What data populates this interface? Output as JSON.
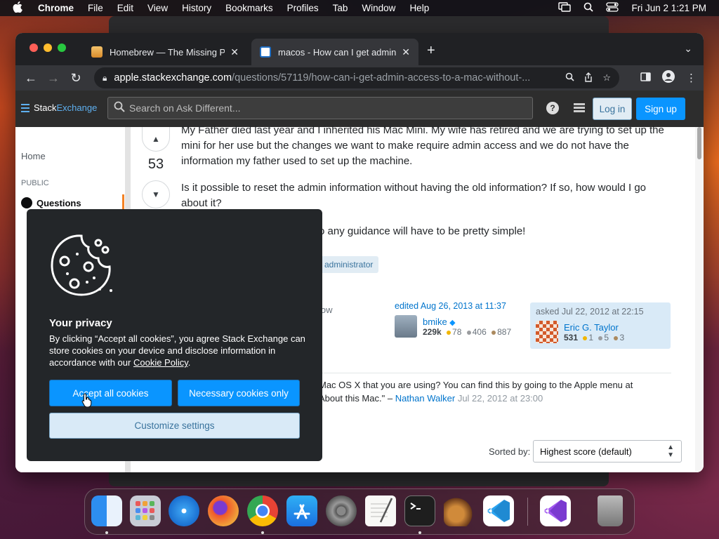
{
  "menubar": {
    "app_name": "Chrome",
    "items": [
      "File",
      "Edit",
      "View",
      "History",
      "Bookmarks",
      "Profiles",
      "Tab",
      "Window",
      "Help"
    ],
    "datetime": "Fri Jun 2  1:21 PM"
  },
  "browser": {
    "tabs": [
      {
        "title": "Homebrew — The Missing Pack",
        "active": false
      },
      {
        "title": "macos - How can I get admin a",
        "active": true
      }
    ],
    "url_host": "apple.stackexchange.com",
    "url_path": "/questions/57119/how-can-i-get-admin-access-to-a-mac-without-..."
  },
  "site_header": {
    "logo_stack": "Stack",
    "logo_exchange": "Exchange",
    "search_placeholder": "Search on Ask Different...",
    "login_label": "Log in",
    "signup_label": "Sign up"
  },
  "sidebar": {
    "home": "Home",
    "section": "PUBLIC",
    "questions": "Questions"
  },
  "question": {
    "vote_count": "53",
    "paragraph1": "My Father died last year and I inherited his Mac Mini. My wife has retired and we are trying to set up the mini for her use but the changes we want to make require admin access and we do not have the information my father used to set up the machine.",
    "paragraph2": "Is it possible to reset the admin information without having the old information? If so, how would I go about it?",
    "paragraph3_fragment": "o any guidance will have to be pretty simple!",
    "tag": "administrator",
    "follow_fragment": "low",
    "edited": {
      "label": "edited Aug 26, 2013 at 11:37",
      "user": "bmike",
      "rep": "229k",
      "gold": "78",
      "silver": "406",
      "bronze": "887"
    },
    "asked": {
      "label": "asked Jul 22, 2012 at 22:15",
      "user": "Eric G. Taylor",
      "rep": "531",
      "gold": "1",
      "silver": "5",
      "bronze": "3"
    },
    "comment": {
      "text1": "Mac OS X that you are using? You can find this by going to the Apple menu at",
      "text2": "About this Mac.\" –",
      "author": "Nathan Walker",
      "time": "Jul 22, 2012 at 23:00"
    }
  },
  "sort": {
    "label": "Sorted by:",
    "value": "Highest score (default)"
  },
  "cookie_dialog": {
    "title": "Your privacy",
    "text": "By clicking “Accept all cookies”, you agree Stack Exchange can store cookies on your device and disclose information in accordance with our",
    "policy_link": "Cookie Policy",
    "text_end": ".",
    "accept_label": "Accept all cookies",
    "necessary_label": "Necessary cookies only",
    "customize_label": "Customize settings"
  },
  "dock": {
    "apps": [
      "finder-icon",
      "launchpad-icon",
      "safari-icon",
      "firefox-icon",
      "chrome-icon",
      "app-store-icon",
      "system-settings-icon",
      "textedit-icon",
      "terminal-icon",
      "garageband-icon",
      "vscode-icon",
      "visual-studio-icon",
      "trash-icon"
    ]
  },
  "colors": {
    "accent": "#0a95ff",
    "link": "#0074cc",
    "dialog_bg": "#232629"
  }
}
